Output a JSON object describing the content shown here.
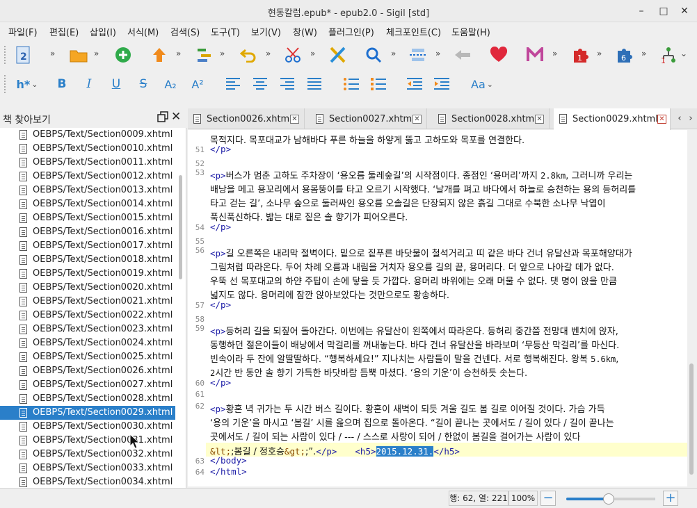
{
  "window": {
    "title": "현동칼럼.epub* - epub2.0 - Sigil [std]",
    "controls": [
      "–",
      "□",
      "✕"
    ]
  },
  "menubar": {
    "items": [
      "파일(F)",
      "편집(E)",
      "삽입(I)",
      "서식(M)",
      "검색(S)",
      "도구(T)",
      "보기(V)",
      "창(W)",
      "플러그인(P)",
      "체크포인트(C)",
      "도움말(H)"
    ]
  },
  "toolbar1": {
    "badges": {
      "plugin1": "1",
      "plugin2": "6",
      "plugin3": "1"
    }
  },
  "toolbar2": {
    "heading_label": "h*",
    "bold": "B",
    "italic": "I",
    "underline": "U",
    "strike": "S",
    "subscript": "A₂",
    "superscript": "A²",
    "case_label": "Aa"
  },
  "dock": {
    "title": "책 찾아보기",
    "files": [
      "OEBPS/Text/Section0009.xhtml",
      "OEBPS/Text/Section0010.xhtml",
      "OEBPS/Text/Section0011.xhtml",
      "OEBPS/Text/Section0012.xhtml",
      "OEBPS/Text/Section0013.xhtml",
      "OEBPS/Text/Section0014.xhtml",
      "OEBPS/Text/Section0015.xhtml",
      "OEBPS/Text/Section0016.xhtml",
      "OEBPS/Text/Section0017.xhtml",
      "OEBPS/Text/Section0018.xhtml",
      "OEBPS/Text/Section0019.xhtml",
      "OEBPS/Text/Section0020.xhtml",
      "OEBPS/Text/Section0021.xhtml",
      "OEBPS/Text/Section0022.xhtml",
      "OEBPS/Text/Section0023.xhtml",
      "OEBPS/Text/Section0024.xhtml",
      "OEBPS/Text/Section0025.xhtml",
      "OEBPS/Text/Section0026.xhtml",
      "OEBPS/Text/Section0027.xhtml",
      "OEBPS/Text/Section0028.xhtml",
      "OEBPS/Text/Section0029.xhtml",
      "OEBPS/Text/Section0030.xhtml",
      "OEBPS/Text/Section0031.xhtml",
      "OEBPS/Text/Section0032.xhtml",
      "OEBPS/Text/Section0033.xhtml",
      "OEBPS/Text/Section0034.xhtml"
    ],
    "selected_file": "OEBPS/Text/Section0029.xhtml"
  },
  "tabs": [
    {
      "label": "Section0026.xhtml",
      "active": false
    },
    {
      "label": "Section0027.xhtml",
      "active": false
    },
    {
      "label": "Section0028.xhtml",
      "active": false
    },
    {
      "label": "Section0029.xhtml",
      "active": true
    }
  ],
  "editor": {
    "line_numbers": [
      "51",
      "52",
      "53",
      "54",
      "55",
      "56",
      "57",
      "58",
      "59",
      "60",
      "61",
      "62",
      "63",
      "64"
    ],
    "line0": "목적지다. 목포대교가 남해바다 푸른 하늘을 하얗게 뚫고 고하도와 목포를 연결한다.",
    "close_p": "</p>",
    "open_p": "<p>",
    "l53a": "버스가 멈춘 고하도 주차장이 ‘용오름 둘레숲길’의 시작점이다. 종점인 ‘용머리’까지 ",
    "l53a_mono": "2.8km",
    "l53a_tail": ", 그러니까 우리는",
    "l53b": "배낭을 메고 용꼬리에서 용몸뚱이를 타고 오르기 시작했다. ‘날개를 펴고 바다에서 하늘로 승천하는 용의 등허리를",
    "l53c": "타고 걷는 길’, 소나무 숲으로 둘러싸인 용오름 오솔길은 단장되지 않은 흙길 그대로 수북한 소나무 낙엽이",
    "l53d": "푹신푹신하다. 밟는 대로 짙은 솔 향기가 피어오른다.",
    "l56a": "길 오른쪽은 내리막 절벽이다. 밑으로 짙푸른 바닷물이 철석거리고 띠 같은 바다 건너 유달산과 목포해양대가",
    "l56b": "그림처럼 따라온다. 두어 차례 오름과 내림을 거치자 용오름 길의 끝, 용머리다. 더 앞으로 나아갈 데가 없다.",
    "l56c": "우뚝 선 목포대교의 하얀 주탑이 손에 닿을 듯 가깝다. 용머리 바위에는 오래 머물 수 없다. 댓 명이 앉을 만큼",
    "l56d": "넓지도 않다. 용머리에 잠깐 앉아보았다는 것만으로도 황송하다.",
    "l59a": "등허리 길을 되짚어 돌아간다. 이번에는 유달산이 왼쪽에서 따라온다. 등허리 중간쯤 전망대 벤치에 앉자,",
    "l59b": "동행하던 젊은이들이 배낭에서 막걸리를 꺼내놓는다. 바다 건너 유달산을 바라보며 ‘무등산 막걸리’를 마신다.",
    "l59c": "빈속이라 두 잔에 알딸딸하다. “행복하세요!” 지나치는 사람들이 말을 건넨다. 서로 행복해진다. 왕복 ",
    "l59c_mono": "5.6km",
    "l59c_tail": ",",
    "l59d_mono": "2",
    "l59d": "시간 반 동안 솔 향기 가득한 바닷바람 듬뿍 마셨다. ‘용의 기운’이 승천하듯 솟는다.",
    "l62a": "황혼 녁 귀가는 두 시간 버스 길이다.  황혼이 새벽이 되듯 겨울 길도 봄 길로 이어질 것이다. 가슴 가득",
    "l62b": "‘용의 기운’을 마시고 ‘봄길’ 시를 읊으며 집으로 돌아온다.  “길이 끝나는 곳에서도 / 길이 있다 / 길이 끝나는",
    "l62c": "곳에서도 / 길이 되는 사람이 있다 /  --- / 스스로 사랑이 되어 / 한없이 봄길을 걸어가는 사람이 있다",
    "l62d_ent1": "&lt;",
    "l62d_text": ";봄길 / 정호승",
    "l62d_ent2": "&gt;",
    "l62d_tail": ";”.",
    "l62d_close": "</p>",
    "l62d_h5open": "<h5>",
    "l62d_date": "2015.12.31.",
    "l62d_h5close": "</h5>",
    "l63": "</body>",
    "l64": "</html>"
  },
  "statusbar": {
    "position": "행: 62, 열: 221",
    "zoom": "100%",
    "zoom_out": "−",
    "zoom_in": "+",
    "zoom_slider_fraction": 0.48
  }
}
